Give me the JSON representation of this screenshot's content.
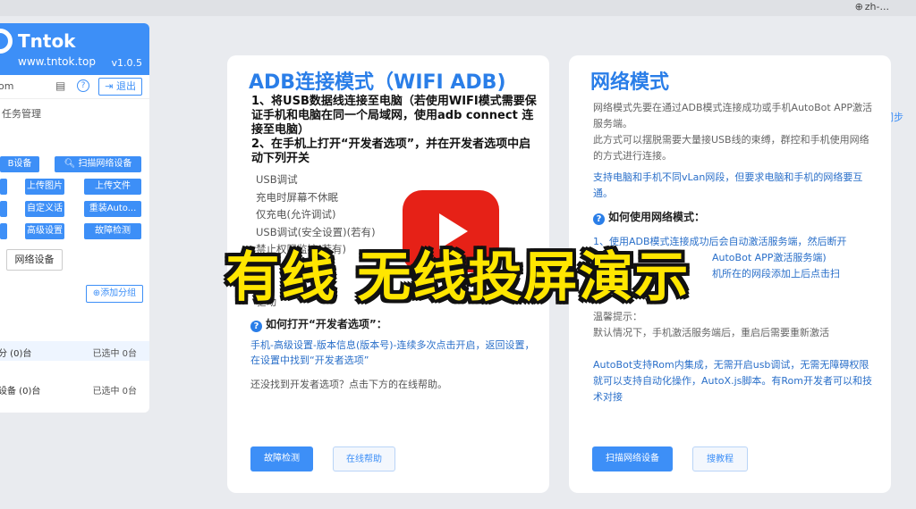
{
  "topbar": {
    "lang": "zh-..."
  },
  "sidebar": {
    "brand": "Tntok",
    "site": "www.tntok.top",
    "version": "v1.0.5",
    "user": "om",
    "logout": "退出",
    "task_label": "任务管理",
    "sync_label": "操作同步",
    "buttons": {
      "device": "B设备",
      "scan": "扫描网络设备",
      "upload_img": "上传图片",
      "upload_file": "上传文件",
      "custom": "自定义话术",
      "reinstall": "重装Auto...",
      "advanced": "高级设置",
      "diagnose": "故障检测"
    },
    "tab_net": "网络设备",
    "add_group": "添加分组",
    "groups": [
      {
        "name": "分 (0)台",
        "selected": "已选中 0台"
      },
      {
        "name": "设备 (0)台",
        "selected": "已选中 0台"
      }
    ]
  },
  "adb_card": {
    "title": "ADB连接模式（WIFI ADB)",
    "step1": "1、将USB数据线连接至电脑（若使用WIFI模式需要保证手机和电脑在同一个局域网，使用adb connect 连接至电脑）",
    "step2": "2、在手机上打开“开发者选项”，并在开发者选项中启动下列开关",
    "options": [
      "USB调试",
      "充电时屏幕不休眠",
      "仅充电(允许调试)",
      "USB调试(安全设置)(若有)",
      "禁止权限监控(若有)",
      "有)",
      "可",
      "驱动"
    ],
    "howto_title": "如何打开“开发者选项”：",
    "howto_body": "手机-高级设置-版本信息(版本号)-连续多次点击开启，返回设置，在设置中找到“开发者选项”",
    "more": "还没找到开发者选项？点击下方的在线帮助。",
    "btn_diagnose": "故障检测",
    "btn_help": "在线帮助"
  },
  "net_card": {
    "title": "网络模式",
    "p1": "网络模式先要在通过ADB模式连接成功或手机AutoBot APP激活服务端。",
    "p2": "此方式可以摆脱需要大量接USB线的束缚，群控和手机使用网络的方式进行连接。",
    "p3": "支持电脑和手机不同vLan网段，但要求电脑和手机的网络要互通。",
    "howto_title": "如何使用网络模式：",
    "s1": "1、使用ADB模式连接成功后会自动激活服务端，然后断开",
    "s2": "AutoBot APP激活服务端)",
    "s3": "机所在的网段添加上后点击扫",
    "tip_title": "温馨提示：",
    "tip": "默认情况下，手机激活服务端后，重启后需要重新激活",
    "p4": "AutoBot支持Rom内集成，无需开启usb调试，无需无障碍权限就可以支持自动化操作，AutoX.js脚本。有Rom开发者可以和技术对接",
    "btn_scan": "扫描网络设备",
    "btn_tutorial": "搜教程"
  },
  "overlay": {
    "caption": "有线 无线投屏演示"
  }
}
